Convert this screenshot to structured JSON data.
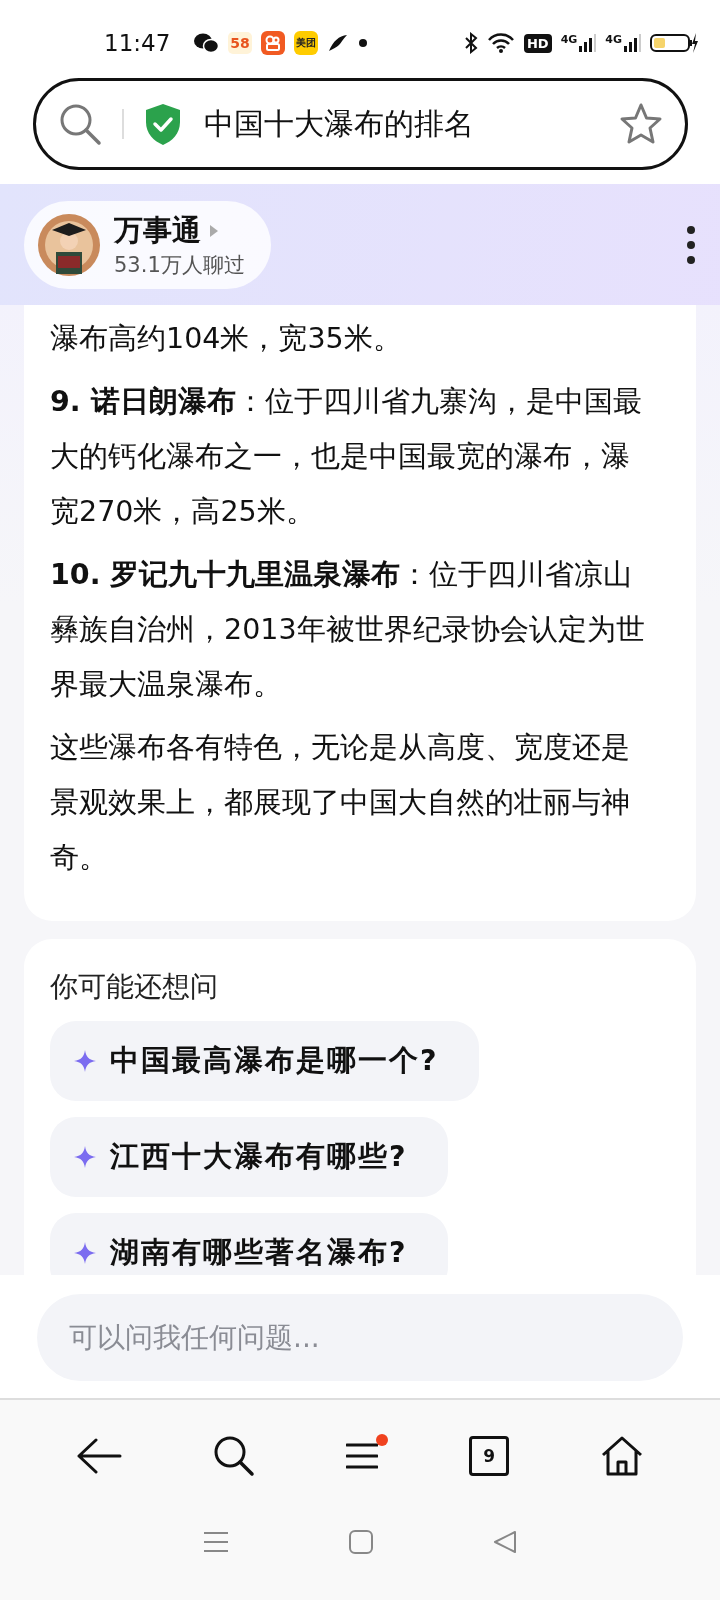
{
  "status_bar": {
    "time": "11:47",
    "app_icons": [
      {
        "kind": "wechat"
      },
      {
        "kind": "fiftyeight",
        "label": "58"
      },
      {
        "kind": "video"
      },
      {
        "kind": "meituan",
        "label": "美团"
      },
      {
        "kind": "bird"
      },
      {
        "kind": "dot"
      }
    ],
    "hd_label": "HD",
    "signal_labels": [
      "4G",
      "4G"
    ]
  },
  "search_bar": {
    "query": "中国十大瀑布的排名",
    "secure": true,
    "starred": false
  },
  "bot": {
    "name": "万事通",
    "stats": "53.1万人聊过"
  },
  "answer": {
    "paragraphs": [
      "瀑布高约104米，宽35米。",
      "**9. 诺日朗瀑布**：位于四川省九寨沟，是中国最大的钙化瀑布之一，也是中国最宽的瀑布，瀑宽270米，高25米。",
      "**10. 罗记九十九里温泉瀑布**：位于四川省凉山彝族自治州，2013年被世界纪录协会认定为世界最大温泉瀑布。",
      "这些瀑布各有特色，无论是从高度、宽度还是景观效果上，都展现了中国大自然的壮丽与神奇。"
    ]
  },
  "suggestions": {
    "title": "你可能还想问",
    "items": [
      "中国最高瀑布是哪一个?",
      "江西十大瀑布有哪些?",
      "湖南有哪些著名瀑布?"
    ]
  },
  "input": {
    "placeholder": "可以问我任何问题..."
  },
  "bottom_nav": [
    {
      "kind": "back"
    },
    {
      "kind": "search"
    },
    {
      "kind": "menu",
      "badge": true
    },
    {
      "kind": "tabs",
      "count": "9"
    },
    {
      "kind": "home"
    }
  ],
  "system_nav": [
    {
      "kind": "recents"
    },
    {
      "kind": "home"
    },
    {
      "kind": "back"
    }
  ]
}
